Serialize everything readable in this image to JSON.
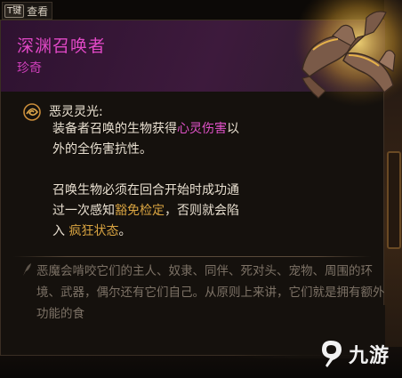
{
  "hotkey": {
    "key": "T键",
    "label": "查看"
  },
  "item": {
    "name": "深渊召唤者",
    "rarity": "珍奇",
    "name_color": "#e148c6",
    "rarity_color": "#d03fbb"
  },
  "ability": {
    "icon": "spiral-eye-icon",
    "name": "恶灵灵光:",
    "lines": [
      {
        "parts": [
          {
            "text": "装备者召唤的生物获得"
          },
          {
            "text": "心灵伤害",
            "hl": "pink"
          },
          {
            "text": "以"
          }
        ]
      },
      {
        "parts": [
          {
            "text": "外的全伤害抗性。"
          }
        ]
      },
      {
        "parts": [
          {
            "text": "召唤生物必须在回合开始时成功通"
          }
        ]
      },
      {
        "parts": [
          {
            "text": "过一次感知"
          },
          {
            "text": "豁免检定",
            "hl": "gold"
          },
          {
            "text": "，否则就会陷"
          }
        ]
      },
      {
        "parts": [
          {
            "text": "入 "
          },
          {
            "text": "疯狂状态",
            "hl": "gold"
          },
          {
            "text": "。"
          }
        ]
      }
    ]
  },
  "flavor": {
    "icon": "quill-icon",
    "text": "恶魔会啃咬它们的主人、奴隶、同伴、死对头、宠物、周围的环境、武器，偶尔还有它们自己。从原则上来讲，它们就是拥有额外功能的食"
  },
  "watermark": {
    "icon": "9you-logo-icon",
    "text": "九游"
  },
  "colors": {
    "pink": "#e152c9",
    "gold": "#d9a441"
  }
}
